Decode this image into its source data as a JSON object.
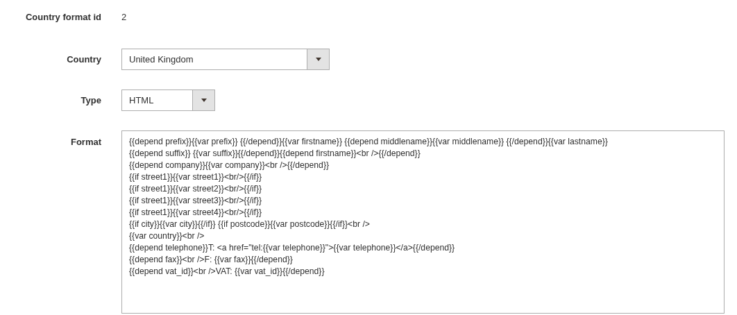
{
  "fields": [
    {
      "kind": "text",
      "label": "Country format id",
      "value": "2"
    },
    {
      "kind": "select",
      "label": "Country",
      "value": "United Kingdom"
    },
    {
      "kind": "select",
      "label": "Type",
      "value": "HTML"
    },
    {
      "kind": "textarea",
      "label": "Format",
      "lines": [
        "{{depend prefix}}{{var prefix}} {{/depend}}{{var firstname}} {{depend middlename}}{{var middlename}} {{/depend}}{{var lastname}}",
        "{{depend suffix}} {{var suffix}}{{/depend}}{{depend firstname}}<br />{{/depend}}",
        "{{depend company}}{{var company}}<br />{{/depend}}",
        "{{if street1}}{{var street1}}<br/>{{/if}}",
        "{{if street1}}{{var street2}}<br/>{{/if}}",
        "{{if street1}}{{var street3}}<br/>{{/if}}",
        "{{if street1}}{{var street4}}<br/>{{/if}}",
        "{{if city}}{{var city}}{{/if}} {{if postcode}}{{var postcode}}{{/if}}<br />",
        "{{var country}}<br />",
        "{{depend telephone}}T: <a href=\"tel:{{var telephone}}\">{{var telephone}}</a>{{/depend}}",
        "{{depend fax}}<br />F: {{var fax}}{{/depend}}",
        "{{depend vat_id}}<br />VAT: {{var vat_id}}{{/depend}}"
      ]
    }
  ]
}
